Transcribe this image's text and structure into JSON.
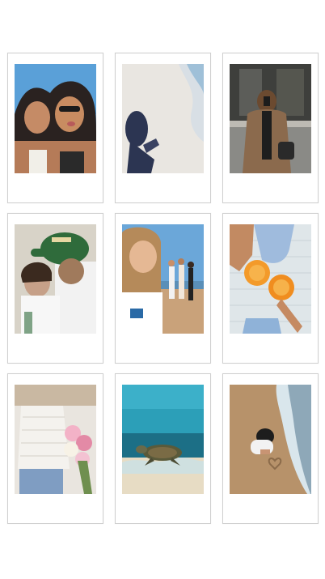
{
  "page": {
    "background": "#ffffff"
  },
  "polaroids": [
    {
      "name": "two-friends-sunglasses-photo",
      "palette": [
        "#5aa0d8",
        "#c68a62",
        "#2a2a2a",
        "#f1efe8"
      ]
    },
    {
      "name": "shadow-on-beach-photo",
      "palette": [
        "#e9e6e1",
        "#7fa7c6",
        "#2c3552"
      ]
    },
    {
      "name": "woman-phone-selfie-street-photo",
      "palette": [
        "#8a8a86",
        "#6b4a30",
        "#1e1e1e"
      ]
    },
    {
      "name": "couple-green-cap-photo",
      "palette": [
        "#2f6b3b",
        "#f2f2f2",
        "#9d7a5c"
      ]
    },
    {
      "name": "girl-beach-friends-photo",
      "palette": [
        "#6ba7d9",
        "#c9a27a",
        "#ffffff"
      ]
    },
    {
      "name": "orange-drinks-cheers-photo",
      "palette": [
        "#dfe6e9",
        "#f39a2a",
        "#8fb2d8"
      ]
    },
    {
      "name": "flowers-white-top-photo",
      "palette": [
        "#e9e5df",
        "#f3b2c7",
        "#7f9dc2"
      ]
    },
    {
      "name": "sea-turtle-underwater-photo",
      "palette": [
        "#2c9fb8",
        "#1c6f86",
        "#e7dcc4"
      ]
    },
    {
      "name": "child-writing-heart-sand-photo",
      "palette": [
        "#b7926a",
        "#e6eef2",
        "#1d1d1d"
      ]
    }
  ]
}
